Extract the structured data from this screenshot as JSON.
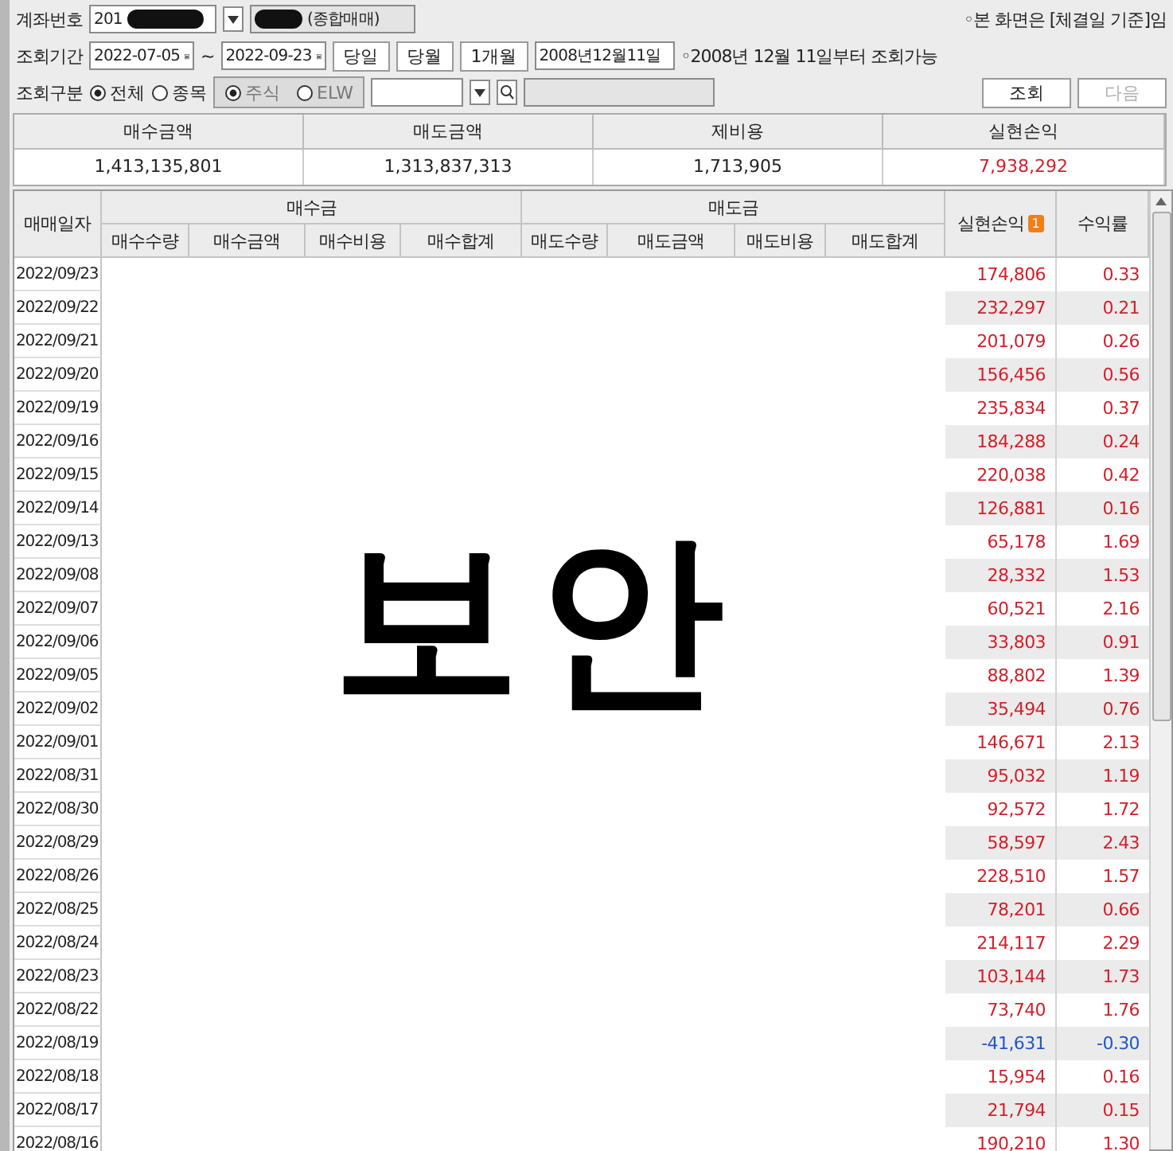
{
  "account": {
    "label": "계좌번호",
    "number": "201",
    "type_text": "(종합매매)",
    "notice": "◦본 화면은 [체결일 기준]임"
  },
  "period": {
    "label": "조회기간",
    "from": "2022-07-05",
    "separator": "~",
    "to": "2022-09-23",
    "buttons": [
      "당일",
      "당월",
      "1개월"
    ],
    "since_field": "2008년12월11일",
    "note": "◦2008년 12월 11일부터 조회가능"
  },
  "filter": {
    "label": "조회구분",
    "scope": [
      {
        "label": "전체",
        "selected": true
      },
      {
        "label": "종목",
        "selected": false
      }
    ],
    "market": {
      "disabled": true,
      "options": [
        {
          "label": "주식",
          "selected": true
        },
        {
          "label": "ELW",
          "selected": false
        }
      ]
    },
    "buttons": [
      {
        "label": "조회",
        "disabled": false
      },
      {
        "label": "다음",
        "disabled": true
      }
    ]
  },
  "summary": [
    {
      "label": "매수금액",
      "value": "1,413,135,801",
      "color": "#222222"
    },
    {
      "label": "매도금액",
      "value": "1,313,837,313",
      "color": "#222222"
    },
    {
      "label": "제비용",
      "value": "1,713,905",
      "color": "#222222"
    },
    {
      "label": "실현손익",
      "value": "7,938,292",
      "color": "#d21f2a"
    }
  ],
  "table": {
    "date_header": "매매일자",
    "groups": [
      {
        "label": "매수금",
        "columns": [
          "매수수량",
          "매수금액",
          "매수비용",
          "매수합계"
        ]
      },
      {
        "label": "매도금",
        "columns": [
          "매도수량",
          "매도금액",
          "매도비용",
          "매도합계"
        ]
      }
    ],
    "profit_header": "실현손익",
    "profit_badge": "1",
    "rate_header": "수익률",
    "overlay": "보안",
    "rows": [
      {
        "date": "2022/09/23",
        "profit": "174,806",
        "rate": "0.33",
        "color": "#d21f2a"
      },
      {
        "date": "2022/09/22",
        "profit": "232,297",
        "rate": "0.21",
        "color": "#d21f2a"
      },
      {
        "date": "2022/09/21",
        "profit": "201,079",
        "rate": "0.26",
        "color": "#d21f2a"
      },
      {
        "date": "2022/09/20",
        "profit": "156,456",
        "rate": "0.56",
        "color": "#d21f2a"
      },
      {
        "date": "2022/09/19",
        "profit": "235,834",
        "rate": "0.37",
        "color": "#d21f2a"
      },
      {
        "date": "2022/09/16",
        "profit": "184,288",
        "rate": "0.24",
        "color": "#d21f2a"
      },
      {
        "date": "2022/09/15",
        "profit": "220,038",
        "rate": "0.42",
        "color": "#d21f2a"
      },
      {
        "date": "2022/09/14",
        "profit": "126,881",
        "rate": "0.16",
        "color": "#d21f2a"
      },
      {
        "date": "2022/09/13",
        "profit": "65,178",
        "rate": "1.69",
        "color": "#d21f2a"
      },
      {
        "date": "2022/09/08",
        "profit": "28,332",
        "rate": "1.53",
        "color": "#d21f2a"
      },
      {
        "date": "2022/09/07",
        "profit": "60,521",
        "rate": "2.16",
        "color": "#d21f2a"
      },
      {
        "date": "2022/09/06",
        "profit": "33,803",
        "rate": "0.91",
        "color": "#d21f2a"
      },
      {
        "date": "2022/09/05",
        "profit": "88,802",
        "rate": "1.39",
        "color": "#d21f2a"
      },
      {
        "date": "2022/09/02",
        "profit": "35,494",
        "rate": "0.76",
        "color": "#d21f2a"
      },
      {
        "date": "2022/09/01",
        "profit": "146,671",
        "rate": "2.13",
        "color": "#d21f2a"
      },
      {
        "date": "2022/08/31",
        "profit": "95,032",
        "rate": "1.19",
        "color": "#d21f2a"
      },
      {
        "date": "2022/08/30",
        "profit": "92,572",
        "rate": "1.72",
        "color": "#d21f2a"
      },
      {
        "date": "2022/08/29",
        "profit": "58,597",
        "rate": "2.43",
        "color": "#d21f2a"
      },
      {
        "date": "2022/08/26",
        "profit": "228,510",
        "rate": "1.57",
        "color": "#d21f2a"
      },
      {
        "date": "2022/08/25",
        "profit": "78,201",
        "rate": "0.66",
        "color": "#d21f2a"
      },
      {
        "date": "2022/08/24",
        "profit": "214,117",
        "rate": "2.29",
        "color": "#d21f2a"
      },
      {
        "date": "2022/08/23",
        "profit": "103,144",
        "rate": "1.73",
        "color": "#d21f2a"
      },
      {
        "date": "2022/08/22",
        "profit": "73,740",
        "rate": "1.76",
        "color": "#d21f2a"
      },
      {
        "date": "2022/08/19",
        "profit": "-41,631",
        "rate": "-0.30",
        "color": "#1f56c8"
      },
      {
        "date": "2022/08/18",
        "profit": "15,954",
        "rate": "0.16",
        "color": "#d21f2a"
      },
      {
        "date": "2022/08/17",
        "profit": "21,794",
        "rate": "0.15",
        "color": "#d21f2a"
      },
      {
        "date": "2022/08/16",
        "profit": "190,210",
        "rate": "1.30",
        "color": "#d21f2a"
      }
    ]
  }
}
